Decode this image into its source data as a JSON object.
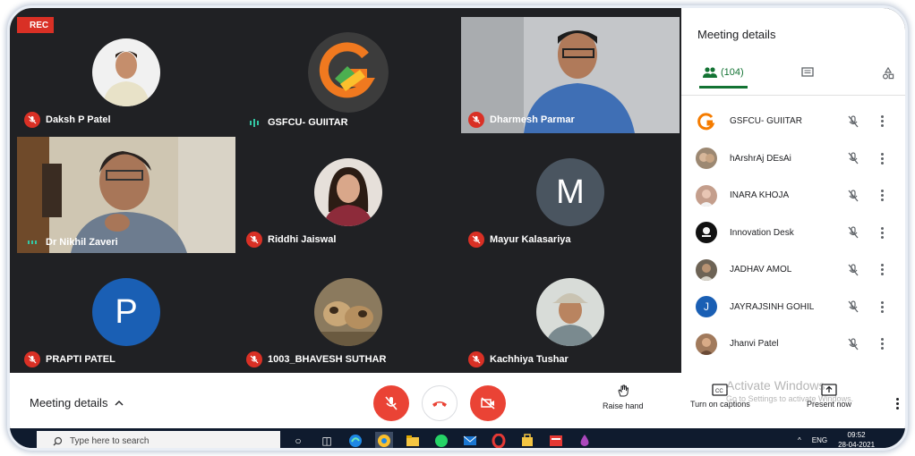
{
  "recording_badge": "REC",
  "tiles": [
    {
      "name": "Daksh P Patel",
      "mic": "off",
      "kind": "photo",
      "bg": "#202124",
      "face": "#c58e6c",
      "shirt": "#e8e2c8"
    },
    {
      "name": "GSFCU- GUIITAR",
      "mic": "speaking",
      "kind": "logo",
      "bg": "#202124"
    },
    {
      "name": "Dharmesh Parmar",
      "mic": "off",
      "kind": "video",
      "bg": "#b9bcc0"
    },
    {
      "name": "Dr Nikhil Zaveri",
      "mic": "speaking",
      "kind": "video",
      "bg": "#8a7a62"
    },
    {
      "name": "Riddhi Jaiswal",
      "mic": "off",
      "kind": "photo",
      "bg": "#202124",
      "face": "#d9a78a",
      "shirt": "#8d2b3a"
    },
    {
      "name": "Mayur Kalasariya",
      "mic": "off",
      "kind": "letter",
      "letter": "M",
      "color": "#4a5560",
      "bg": "#202124"
    },
    {
      "name": "PRAPTI PATEL",
      "mic": "off",
      "kind": "letter",
      "letter": "P",
      "color": "#1a5fb4",
      "bg": "#202124"
    },
    {
      "name": "1003_BHAVESH SUTHAR",
      "mic": "off",
      "kind": "photo",
      "bg": "#202124",
      "face": "#a88b5a",
      "shirt": "#c9b38e"
    },
    {
      "name": "Kachhiya Tushar",
      "mic": "off",
      "kind": "photo",
      "bg": "#202124",
      "face": "#b98460",
      "shirt": "#7a8a8f"
    }
  ],
  "panel": {
    "title": "Meeting details",
    "people_count": "(104)",
    "participants": [
      {
        "name": "GSFCU- GUIITAR",
        "avatar": "logo",
        "color": "#f57c00"
      },
      {
        "name": "hArshrAj DEsAi",
        "avatar": "photo",
        "color": "#9c8872"
      },
      {
        "name": "INARA KHOJA",
        "avatar": "photo",
        "color": "#c49e8c"
      },
      {
        "name": "Innovation Desk",
        "avatar": "photo",
        "color": "#111111"
      },
      {
        "name": "JADHAV AMOL",
        "avatar": "photo",
        "color": "#6d6355"
      },
      {
        "name": "JAYRAJSINH GOHIL",
        "avatar": "letter",
        "letter": "J",
        "color": "#1a5fb4"
      },
      {
        "name": "Jhanvi Patel",
        "avatar": "photo",
        "color": "#a17a5c"
      }
    ]
  },
  "bottom": {
    "meeting_details": "Meeting details",
    "raise_hand": "Raise hand",
    "captions": "Turn on captions",
    "present": "Present now",
    "activate_title": "Activate Windows",
    "activate_sub": "Go to Settings to activate Windows."
  },
  "taskbar": {
    "search_placeholder": "Type here to search",
    "lang": "ENG",
    "time": "09:52",
    "date": "28-04-2021"
  },
  "colors": {
    "mic_off": "#d93025",
    "accent_green": "#137333",
    "end_call": "#ea4335"
  }
}
